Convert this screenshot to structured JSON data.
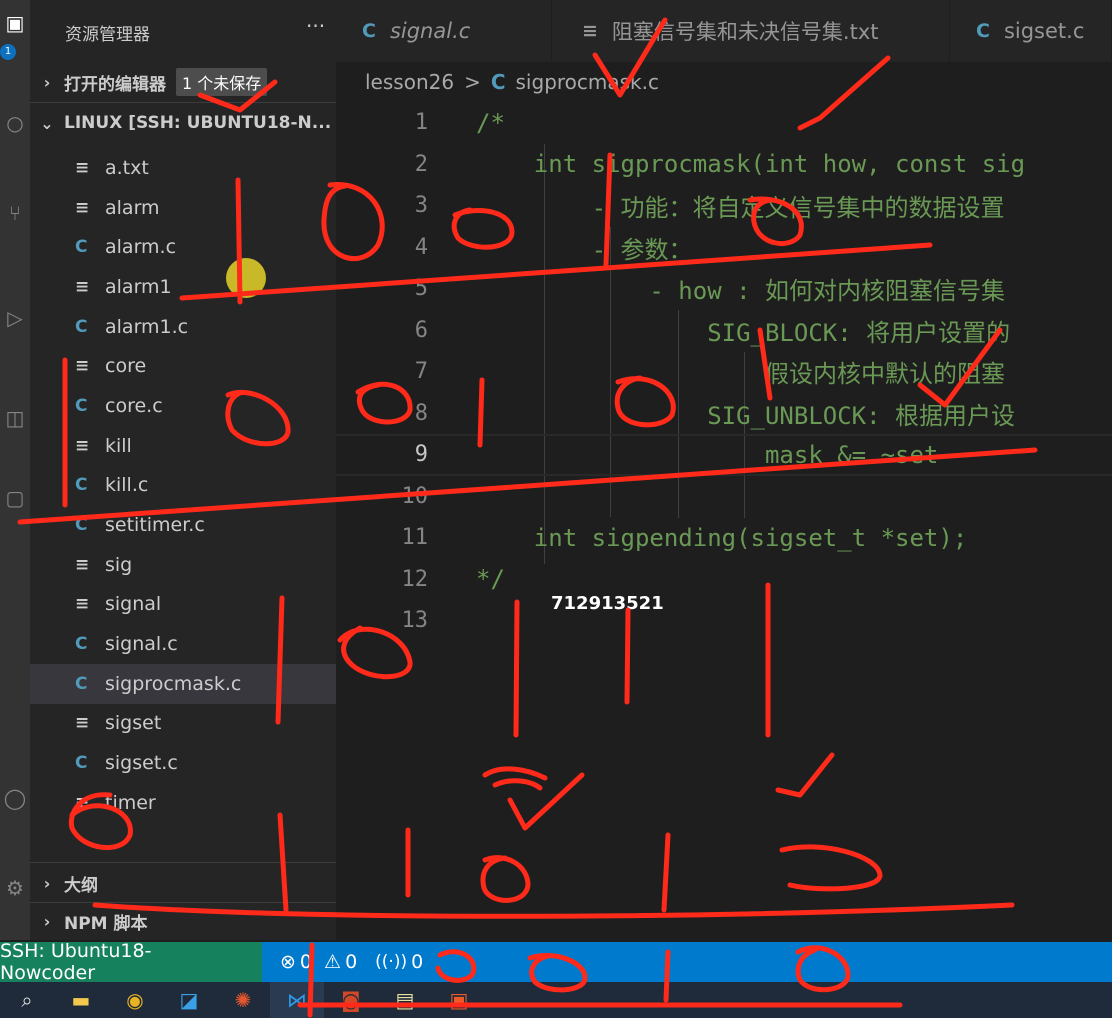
{
  "explorer": {
    "title": "资源管理器",
    "more": "···",
    "open_editors": "打开的编辑器",
    "unsaved_badge": "1 个未保存",
    "workspace": "LINUX [SSH: UBUNTU18-N...",
    "files": [
      {
        "name": "a.txt",
        "type": "txt"
      },
      {
        "name": "alarm",
        "type": "txt"
      },
      {
        "name": "alarm.c",
        "type": "c"
      },
      {
        "name": "alarm1",
        "type": "txt"
      },
      {
        "name": "alarm1.c",
        "type": "c"
      },
      {
        "name": "core",
        "type": "txt"
      },
      {
        "name": "core.c",
        "type": "c"
      },
      {
        "name": "kill",
        "type": "txt"
      },
      {
        "name": "kill.c",
        "type": "c"
      },
      {
        "name": "setitimer.c",
        "type": "c"
      },
      {
        "name": "sig",
        "type": "txt"
      },
      {
        "name": "signal",
        "type": "txt"
      },
      {
        "name": "signal.c",
        "type": "c"
      },
      {
        "name": "sigprocmask.c",
        "type": "c",
        "selected": true
      },
      {
        "name": "sigset",
        "type": "txt"
      },
      {
        "name": "sigset.c",
        "type": "c"
      },
      {
        "name": "timer",
        "type": "txt"
      }
    ],
    "outline": "大纲",
    "npm": "NPM 脚本"
  },
  "tabs": [
    {
      "label": "signal.c",
      "type": "c"
    },
    {
      "label": "阻塞信号集和未决信号集.txt",
      "type": "txt"
    },
    {
      "label": "sigset.c",
      "type": "c"
    }
  ],
  "breadcrumb": {
    "folder": "lesson26",
    "sep": ">",
    "file": "sigprocmask.c"
  },
  "code": [
    {
      "n": "1",
      "text": "/*"
    },
    {
      "n": "2",
      "text": "    int sigprocmask(int how, const sig"
    },
    {
      "n": "3",
      "text": "        - 功能：将自定义信号集中的数据设置"
    },
    {
      "n": "4",
      "text": "        - 参数："
    },
    {
      "n": "5",
      "text": "            - how : 如何对内核阻塞信号集"
    },
    {
      "n": "6",
      "text": "                SIG_BLOCK: 将用户设置的"
    },
    {
      "n": "7",
      "text": "                    假设内核中默认的阻塞"
    },
    {
      "n": "8",
      "text": "                SIG_UNBLOCK: 根据用户设"
    },
    {
      "n": "9",
      "text": "                    mask &= ~set"
    },
    {
      "n": "10",
      "text": ""
    },
    {
      "n": "11",
      "text": "    int sigpending(sigset_t *set);"
    },
    {
      "n": "12",
      "text": "*/"
    },
    {
      "n": "13",
      "text": ""
    }
  ],
  "watermark": "712913521",
  "status": {
    "remote": "SSH: Ubuntu18-Nowcoder",
    "errors": "0",
    "warnings": "0",
    "ports": "0"
  },
  "icons": {
    "error": "⊗",
    "warning": "⚠",
    "broadcast": "📡",
    "chevron_right": "›",
    "chevron_down": "⌄",
    "file_c": "C",
    "file_txt": "≡"
  },
  "colors": {
    "accent": "#007acc",
    "remote": "#16825d",
    "comment": "#6a9955",
    "c_icon": "#519aba",
    "ink": "#ff2a1a"
  }
}
